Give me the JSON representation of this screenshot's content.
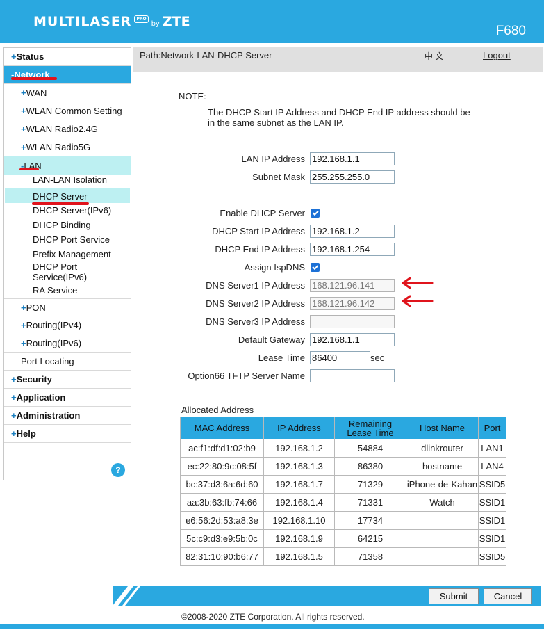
{
  "header": {
    "brand": "MULTILASER",
    "brand_badge": "PRO",
    "brand_by": "by",
    "brand_zte": "ZTE",
    "model": "F680",
    "accent_color": "#2aa8e0"
  },
  "sidebar": {
    "status": "Status",
    "network": "Network",
    "wan": "WAN",
    "wlan_common": "WLAN Common Setting",
    "wlan_24": "WLAN Radio2.4G",
    "wlan_5": "WLAN Radio5G",
    "lan": "LAN",
    "lan_sub": [
      "LAN-LAN Isolation",
      "DHCP Server",
      "DHCP Server(IPv6)",
      "DHCP Binding",
      "DHCP Port Service",
      "Prefix Management",
      "DHCP Port Service(IPv6)",
      "RA Service"
    ],
    "pon": "PON",
    "routing_v4": "Routing(IPv4)",
    "routing_v6": "Routing(IPv6)",
    "port_locating": "Port Locating",
    "security": "Security",
    "application": "Application",
    "administration": "Administration",
    "help": "Help",
    "help_icon": "?"
  },
  "pathbar": {
    "path": "Path:Network-LAN-DHCP Server",
    "language": "中 文",
    "logout": "Logout"
  },
  "note": {
    "label": "NOTE:",
    "text": "The DHCP Start IP Address and DHCP End IP address should be in the same subnet as the LAN IP."
  },
  "form": {
    "lan_ip_label": "LAN IP Address",
    "lan_ip": "192.168.1.1",
    "subnet_label": "Subnet Mask",
    "subnet": "255.255.255.0",
    "enable_dhcp_label": "Enable DHCP Server",
    "enable_dhcp": true,
    "start_ip_label": "DHCP Start IP Address",
    "start_ip": "192.168.1.2",
    "end_ip_label": "DHCP End IP Address",
    "end_ip": "192.168.1.254",
    "assign_dns_label": "Assign IspDNS",
    "assign_dns": true,
    "dns1_label": "DNS Server1 IP Address",
    "dns1": "168.121.96.141",
    "dns2_label": "DNS Server2 IP Address",
    "dns2": "168.121.96.142",
    "dns3_label": "DNS Server3 IP Address",
    "dns3": "",
    "gateway_label": "Default Gateway",
    "gateway": "192.168.1.1",
    "lease_label": "Lease Time",
    "lease": "86400",
    "lease_unit": "sec",
    "option66_label": "Option66 TFTP Server Name",
    "option66": ""
  },
  "allocated": {
    "title": "Allocated Address",
    "headers": [
      "MAC Address",
      "IP Address",
      "Remaining Lease Time",
      "Host Name",
      "Port"
    ],
    "rows": [
      [
        "ac:f1:df:d1:02:b9",
        "192.168.1.2",
        "54884",
        "dlinkrouter",
        "LAN1"
      ],
      [
        "ec:22:80:9c:08:5f",
        "192.168.1.3",
        "86380",
        "hostname",
        "LAN4"
      ],
      [
        "bc:37:d3:6a:6d:60",
        "192.168.1.7",
        "71329",
        "iPhone-de-Kahan",
        "SSID5"
      ],
      [
        "aa:3b:63:fb:74:66",
        "192.168.1.4",
        "71331",
        "Watch",
        "SSID1"
      ],
      [
        "e6:56:2d:53:a8:3e",
        "192.168.1.10",
        "17734",
        "",
        "SSID1"
      ],
      [
        "5c:c9:d3:e9:5b:0c",
        "192.168.1.9",
        "64215",
        "",
        "SSID1"
      ],
      [
        "82:31:10:90:b6:77",
        "192.168.1.5",
        "71358",
        "",
        "SSID5"
      ]
    ]
  },
  "buttons": {
    "submit": "Submit",
    "cancel": "Cancel"
  },
  "footer": {
    "copyright": "©2008-2020 ZTE Corporation. All rights reserved."
  }
}
